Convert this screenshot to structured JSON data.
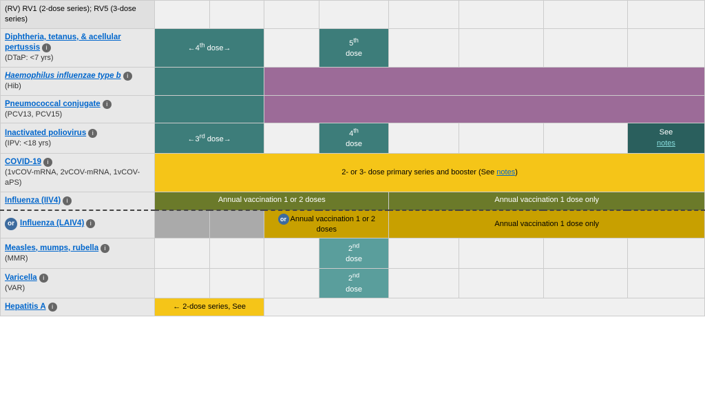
{
  "rows": [
    {
      "id": "rv",
      "vaccine_html": "(RV) RV1 (2-dose series); RV5 (3-dose series)",
      "is_link": false,
      "cells": [
        {
          "type": "empty",
          "colspan": 1
        },
        {
          "type": "empty",
          "colspan": 1
        },
        {
          "type": "empty",
          "colspan": 1
        },
        {
          "type": "empty",
          "colspan": 1
        },
        {
          "type": "empty",
          "colspan": 1
        },
        {
          "type": "empty",
          "colspan": 1
        },
        {
          "type": "empty",
          "colspan": 1
        },
        {
          "type": "empty",
          "colspan": 1
        }
      ]
    },
    {
      "id": "dtap",
      "vaccine_name": "Diphtheria, tetanus, & acellular pertussis",
      "vaccine_sub": "(DTaP: <7 yrs)",
      "is_link": true,
      "has_info": true,
      "cells": [
        {
          "type": "teal",
          "text": "←4th dose→",
          "colspan": 2
        },
        {
          "type": "empty",
          "colspan": 1
        },
        {
          "type": "teal",
          "text": "5th\ndose",
          "colspan": 1
        },
        {
          "type": "empty",
          "colspan": 1
        },
        {
          "type": "empty",
          "colspan": 1
        },
        {
          "type": "empty",
          "colspan": 1
        },
        {
          "type": "empty",
          "colspan": 1
        }
      ]
    },
    {
      "id": "hib",
      "vaccine_name": "Haemophilus influenzae type b",
      "vaccine_sub": "(Hib)",
      "is_link": true,
      "is_italic": true,
      "has_info": true,
      "cells": [
        {
          "type": "teal",
          "text": "",
          "colspan": 2
        },
        {
          "type": "purple",
          "text": "",
          "colspan": 6
        }
      ]
    },
    {
      "id": "pcv",
      "vaccine_name": "Pneumococcal conjugate",
      "vaccine_sub": "(PCV13, PCV15)",
      "is_link": true,
      "has_info": true,
      "cells": [
        {
          "type": "teal",
          "text": "",
          "colspan": 2
        },
        {
          "type": "purple",
          "text": "",
          "colspan": 6
        }
      ]
    },
    {
      "id": "ipv",
      "vaccine_name": "Inactivated poliovirus",
      "vaccine_sub": "(IPV: <18 yrs)",
      "is_link": true,
      "has_info": true,
      "cells": [
        {
          "type": "teal",
          "text": "←3rd dose→",
          "colspan": 2
        },
        {
          "type": "empty",
          "colspan": 1
        },
        {
          "type": "teal",
          "text": "4th\ndose",
          "colspan": 1
        },
        {
          "type": "empty",
          "colspan": 1
        },
        {
          "type": "empty",
          "colspan": 1
        },
        {
          "type": "empty",
          "colspan": 1
        },
        {
          "type": "dark-teal",
          "text": "See\nnotes",
          "colspan": 1
        }
      ]
    },
    {
      "id": "covid",
      "vaccine_name": "COVID-19",
      "vaccine_sub": "(1vCOV-mRNA, 2vCOV-mRNA, 1vCOV-aPS)",
      "is_link": true,
      "has_info": true,
      "cells": [
        {
          "type": "yellow",
          "text": "2- or 3- dose primary series and booster (See notes)",
          "colspan": 8
        }
      ]
    },
    {
      "id": "influenza_iiv4",
      "vaccine_name": "Influenza (IIV4)",
      "vaccine_sub": "",
      "is_link": true,
      "has_info": true,
      "is_dashed_bottom": true,
      "cells": [
        {
          "type": "olive",
          "text": "Annual vaccination 1 or 2 doses",
          "colspan": 4
        },
        {
          "type": "olive",
          "text": "Annual vaccination 1 dose only",
          "colspan": 4
        }
      ]
    },
    {
      "id": "influenza_laiv4",
      "vaccine_name": "Influenza (LAIV4)",
      "vaccine_sub": "",
      "is_link": true,
      "has_info": true,
      "has_or_prefix": true,
      "cells": [
        {
          "type": "gray-cell",
          "text": "",
          "colspan": 1
        },
        {
          "type": "gray-cell",
          "text": "",
          "colspan": 1
        },
        {
          "type": "yellow-dark",
          "text": "Annual vaccination 1 or 2\ndoses",
          "colspan": 2,
          "has_or": true
        },
        {
          "type": "yellow-dark",
          "text": "Annual vaccination 1 dose only",
          "colspan": 4
        }
      ]
    },
    {
      "id": "mmr",
      "vaccine_name": "Measles, mumps, rubella",
      "vaccine_sub": "(MMR)",
      "is_link": true,
      "has_info": true,
      "cells": [
        {
          "type": "empty",
          "colspan": 1
        },
        {
          "type": "empty",
          "colspan": 1
        },
        {
          "type": "empty",
          "colspan": 1
        },
        {
          "type": "teal-light",
          "text": "2nd\ndose",
          "colspan": 1
        },
        {
          "type": "empty",
          "colspan": 1
        },
        {
          "type": "empty",
          "colspan": 1
        },
        {
          "type": "empty",
          "colspan": 1
        },
        {
          "type": "empty",
          "colspan": 1
        }
      ]
    },
    {
      "id": "varicella",
      "vaccine_name": "Varicella",
      "vaccine_sub": "(VAR)",
      "is_link": true,
      "has_info": true,
      "cells": [
        {
          "type": "empty",
          "colspan": 1
        },
        {
          "type": "empty",
          "colspan": 1
        },
        {
          "type": "empty",
          "colspan": 1
        },
        {
          "type": "teal-light",
          "text": "2nd\ndose",
          "colspan": 1
        },
        {
          "type": "empty",
          "colspan": 1
        },
        {
          "type": "empty",
          "colspan": 1
        },
        {
          "type": "empty",
          "colspan": 1
        },
        {
          "type": "empty",
          "colspan": 1
        }
      ]
    },
    {
      "id": "hepa",
      "vaccine_name": "Hepatitis A",
      "vaccine_sub": "",
      "is_link": true,
      "has_info": true,
      "cells": [
        {
          "type": "yellow",
          "text": "← 2-dose series, See",
          "colspan": 2
        },
        {
          "type": "empty",
          "colspan": 6
        }
      ]
    }
  ]
}
